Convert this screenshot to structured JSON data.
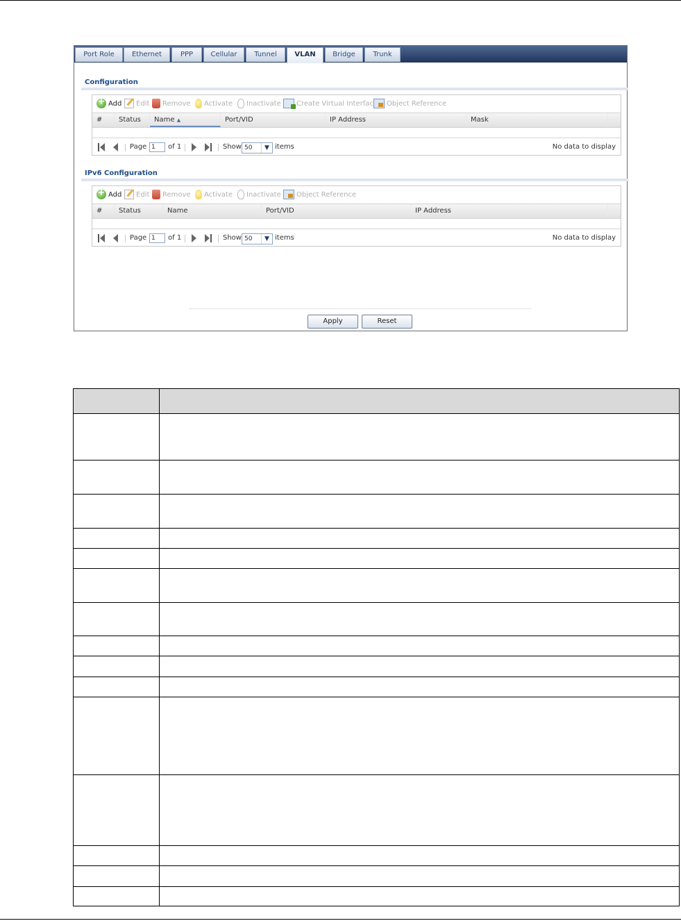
{
  "tabs": [
    {
      "label": "Port Role",
      "active": false
    },
    {
      "label": "Ethernet",
      "active": false
    },
    {
      "label": "PPP",
      "active": false
    },
    {
      "label": "Cellular",
      "active": false
    },
    {
      "label": "Tunnel",
      "active": false
    },
    {
      "label": "VLAN",
      "active": true
    },
    {
      "label": "Bridge",
      "active": false
    },
    {
      "label": "Trunk",
      "active": false
    }
  ],
  "config": {
    "title": "Configuration",
    "toolbar": {
      "add": "Add",
      "edit": "Edit",
      "remove": "Remove",
      "activate": "Activate",
      "inactivate": "Inactivate",
      "create_virtual": "Create Virtual Interface",
      "object_reference": "Object Reference"
    },
    "columns": [
      "#",
      "Status",
      "Name",
      "Port/VID",
      "IP Address",
      "Mask"
    ],
    "sort_indicator": "▲",
    "pager": {
      "page_label": "Page",
      "page_value": "1",
      "of_label": "of 1",
      "show_label": "Show",
      "show_value": "50",
      "items_label": "items",
      "no_data": "No data to display"
    }
  },
  "ipv6": {
    "title": "IPv6 Configuration",
    "toolbar": {
      "add": "Add",
      "edit": "Edit",
      "remove": "Remove",
      "activate": "Activate",
      "inactivate": "Inactivate",
      "object_reference": "Object Reference"
    },
    "columns": [
      "#",
      "Status",
      "Name",
      "Port/VID",
      "IP Address"
    ],
    "pager": {
      "page_label": "Page",
      "page_value": "1",
      "of_label": "of 1",
      "show_label": "Show",
      "show_value": "50",
      "items_label": "items",
      "no_data": "No data to display"
    }
  },
  "buttons": {
    "apply": "Apply",
    "reset": "Reset"
  },
  "colors": {
    "tab_bar": "#21355d",
    "section_title": "#1f4e8c",
    "table_header": "#d9d9d9"
  }
}
